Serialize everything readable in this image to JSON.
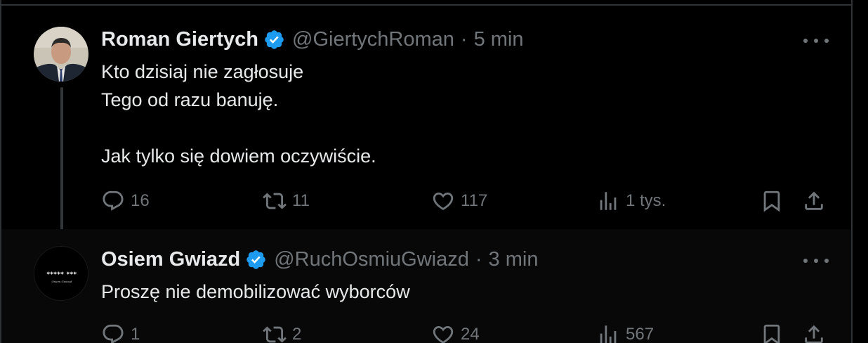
{
  "tweets": [
    {
      "author_name": "Roman Giertych",
      "handle": "@GiertychRoman",
      "separator": "·",
      "time": "5 min",
      "text": "Kto dzisiaj nie zagłosuje\nTego od razu banuję.\n\nJak tylko się dowiem oczywiście.",
      "actions": {
        "replies": "16",
        "reposts": "11",
        "likes": "117",
        "views": "1 tys."
      }
    },
    {
      "author_name": "Osiem Gwiazd",
      "handle": "@RuchOsmiuGwiazd",
      "separator": "·",
      "time": "3 min",
      "text": "Proszę nie demobilizować wyborców",
      "avatar_text": "***** ***",
      "avatar_subtext": "Osiem Gwiazd",
      "actions": {
        "replies": "1",
        "reposts": "2",
        "likes": "24",
        "views": "567"
      }
    }
  ],
  "icons": {
    "verified": "verified-badge-icon",
    "more": "more-icon",
    "reply": "reply-icon",
    "repost": "repost-icon",
    "like": "like-icon",
    "views": "views-icon",
    "bookmark": "bookmark-icon",
    "share": "share-icon"
  },
  "colors": {
    "background": "#000000",
    "text": "#e7e9ea",
    "muted": "#71767b",
    "verified": "#1d9bf0",
    "border": "#2f3336"
  }
}
